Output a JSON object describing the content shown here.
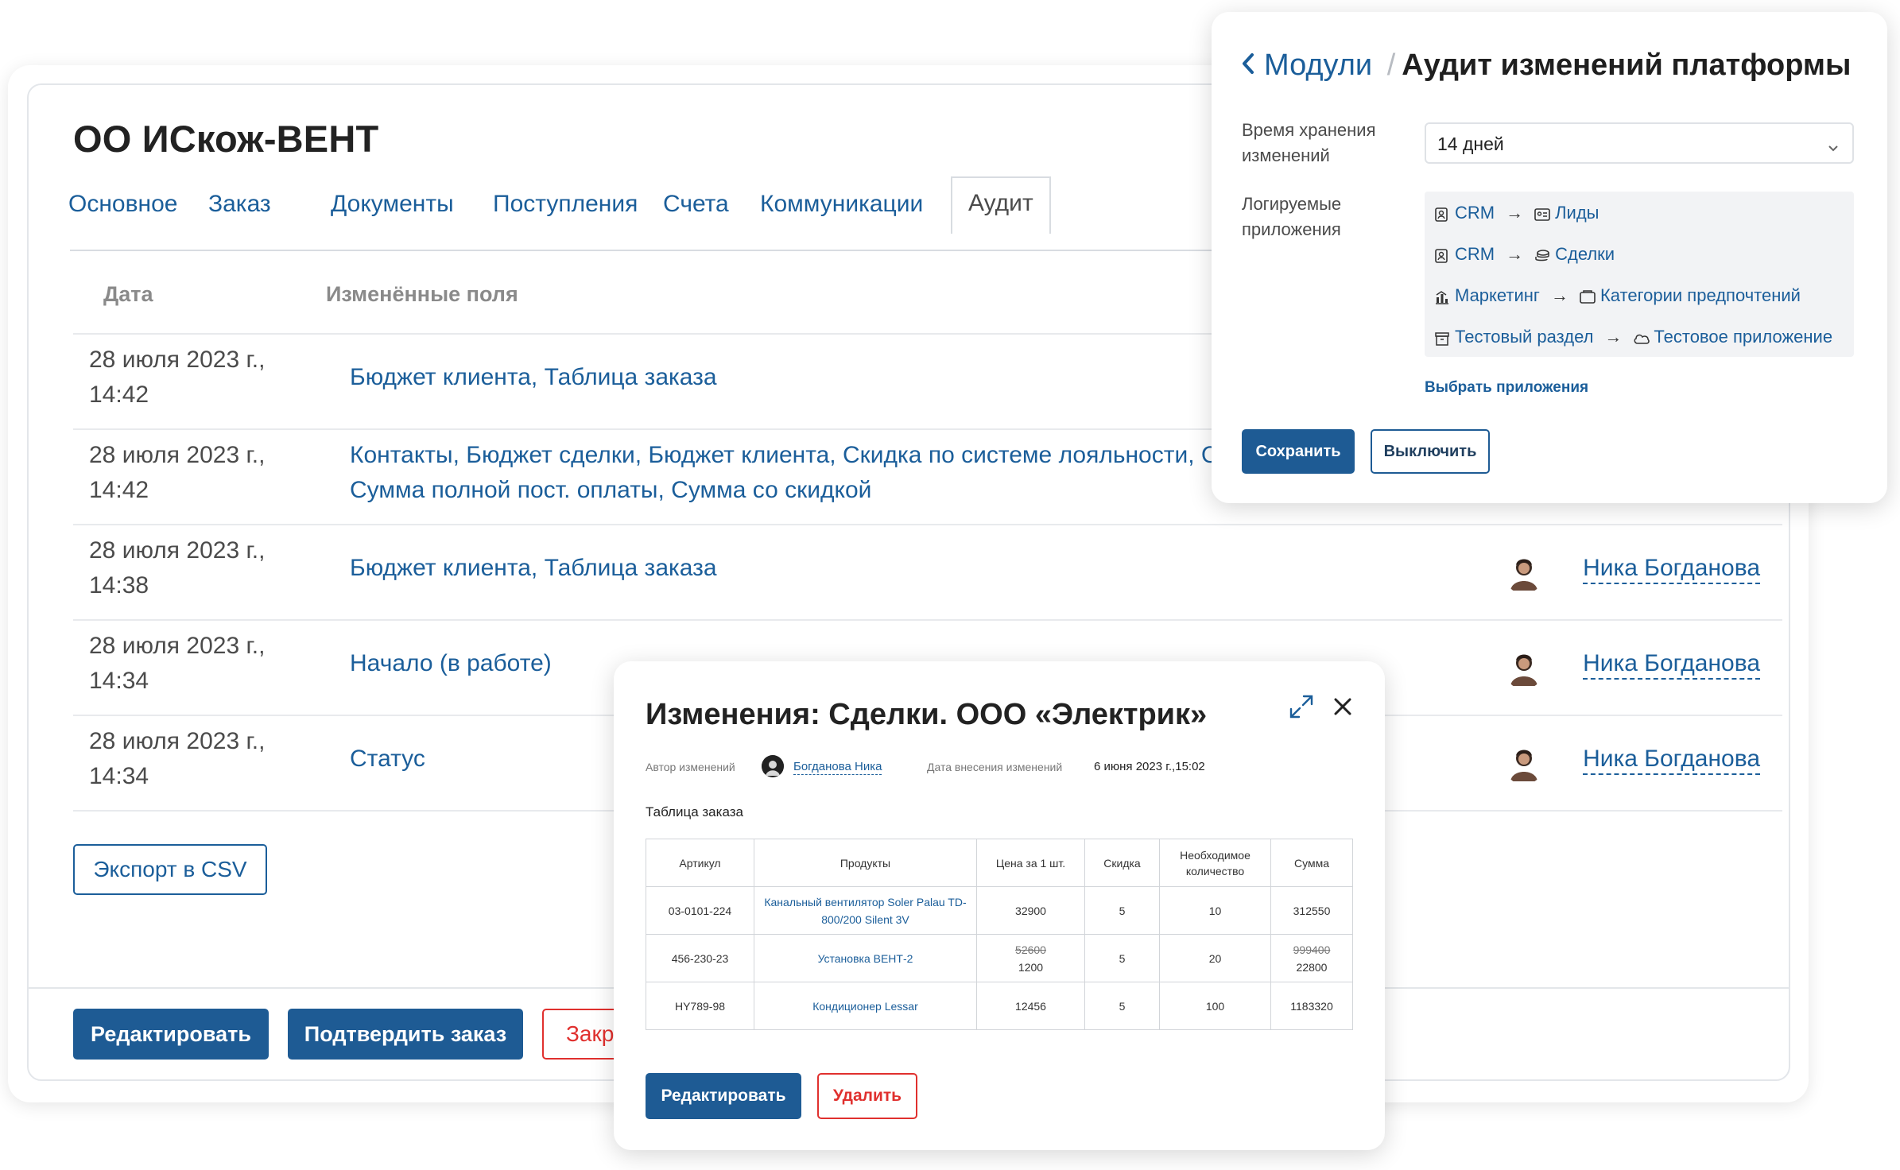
{
  "order": {
    "title": "ОО ИСкож-ВЕНТ",
    "tabs": [
      "Основное",
      "Заказ",
      "Документы",
      "Поступления",
      "Счета",
      "Коммуникации",
      "Аудит"
    ],
    "columns": {
      "date": "Дата",
      "fields": "Изменённые поля"
    },
    "rows": [
      {
        "date": "28 июля 2023 г., 14:42",
        "fields_line1": "Бюджет клиента, Таблица заказа",
        "fields_line2": "",
        "author": ""
      },
      {
        "date": "28 июля 2023 г., 14:42",
        "fields_line1": "Контакты, Бюджет сделки, Бюджет клиента, Скидка по системе лояльности, Схема о",
        "fields_line2": "Сумма полной пост. оплаты, Сумма со скидкой",
        "author": ""
      },
      {
        "date": "28 июля 2023 г., 14:38",
        "fields_line1": "Бюджет клиента, Таблица заказа",
        "fields_line2": "",
        "author": "Ника Богданова"
      },
      {
        "date": "28 июля 2023 г., 14:34",
        "fields_line1": "Начало (в работе)",
        "fields_line2": "",
        "author": "Ника Богданова"
      },
      {
        "date": "28 июля 2023 г., 14:34",
        "fields_line1": "Статус",
        "fields_line2": "",
        "author": "Ника Богданова"
      }
    ],
    "export_label": "Экспорт в CSV",
    "footer": {
      "edit_label": "Редактировать",
      "confirm_label": "Подтвердить заказ",
      "close_label": "Закр"
    }
  },
  "settings": {
    "breadcrumb_parent": "Модули",
    "separator": "/",
    "title": "Аудит изменений платформы",
    "retention_label": "Время хранения изменений",
    "retention_value": "14 дней",
    "apps_label": "Логируемые приложения",
    "apps": [
      {
        "from": "CRM",
        "from_icon": "contact-card-icon",
        "to": "Лиды",
        "to_icon": "id-card-icon"
      },
      {
        "from": "CRM",
        "from_icon": "contact-card-icon",
        "to": "Сделки",
        "to_icon": "coins-icon"
      },
      {
        "from": "Маркетинг",
        "from_icon": "bar-chart-icon",
        "to": "Категории предпочтений",
        "to_icon": "folder-icon"
      },
      {
        "from": "Тестовый раздел",
        "from_icon": "archive-icon",
        "to": "Тестовое приложение",
        "to_icon": "cloud-icon"
      }
    ],
    "select_apps_label": "Выбрать приложения",
    "save_label": "Сохранить",
    "disable_label": "Выключить"
  },
  "changes": {
    "title": "Изменения: Сделки. ООО «Электрик»",
    "author_label": "Автор изменений",
    "author": "Богданова Ника",
    "date_label": "Дата внесения изменений",
    "date": "6 июня 2023 г.,15:02",
    "section": "Таблица заказа",
    "table": {
      "headers": [
        "Артикул",
        "Продукты",
        "Цена за 1 шт.",
        "Скидка",
        "Необходимое количество",
        "Сумма"
      ],
      "rows": [
        {
          "sku": "03-0101-224",
          "product": "Канальный вентилятор Soler Palau TD-800/200 Silent 3V",
          "price_old": "",
          "price": "32900",
          "discount": "5",
          "qty": "10",
          "sum_old": "",
          "sum": "312550"
        },
        {
          "sku": "456-230-23",
          "product": "Установка ВЕНТ-2",
          "price_old": "52600",
          "price": "1200",
          "discount": "5",
          "qty": "20",
          "sum_old": "999400",
          "sum": "22800"
        },
        {
          "sku": "HY789-98",
          "product": "Кондиционер Lessar",
          "price_old": "",
          "price": "12456",
          "discount": "5",
          "qty": "100",
          "sum_old": "",
          "sum": "1183320"
        }
      ]
    },
    "edit_label": "Редактировать",
    "delete_label": "Удалить"
  },
  "colors": {
    "link": "#1b5e9a",
    "primary": "#1e5b94",
    "danger": "#e0302e"
  }
}
